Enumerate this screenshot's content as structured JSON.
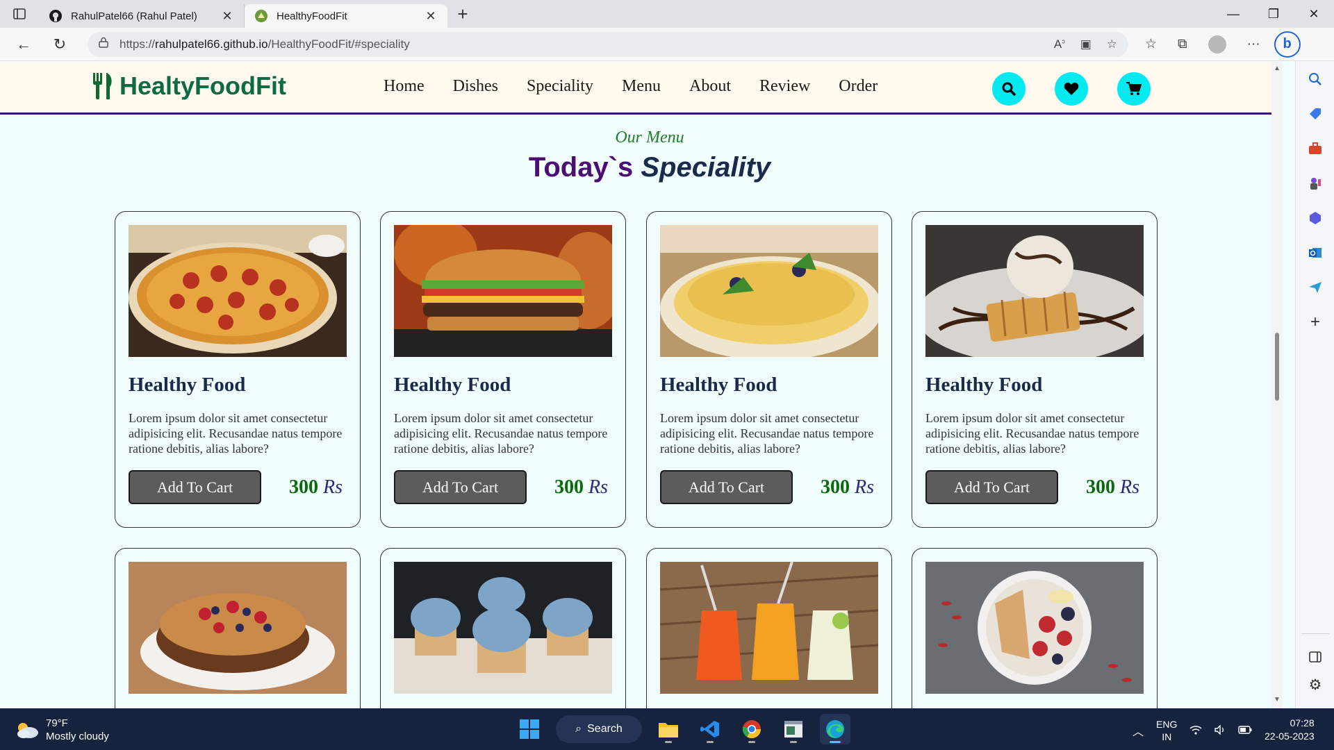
{
  "browser": {
    "tabs": [
      {
        "title": "RahulPatel66 (Rahul Patel)",
        "icon": "github-icon",
        "active": false
      },
      {
        "title": "HealthyFoodFit",
        "icon": "site-favicon",
        "active": true
      }
    ],
    "url_prefix": "https://",
    "url_host": "rahulpatel66.github.io",
    "url_path": "/HealthyFoodFit/#speciality"
  },
  "site": {
    "logo_text": "HealtyFoodFit",
    "nav": [
      "Home",
      "Dishes",
      "Speciality",
      "Menu",
      "About",
      "Review",
      "Order"
    ],
    "header_icons": [
      "search-icon",
      "heart-icon",
      "cart-icon"
    ],
    "section_sub": "Our Menu",
    "section_title_a": "Today`s ",
    "section_title_b": "Speciality",
    "cards": [
      {
        "title": "Healthy Food",
        "desc": "Lorem ipsum dolor sit amet consectetur adipisicing elit. Recusandae natus tempore ratione debitis, alias labore?",
        "button": "Add To Cart",
        "price": "300",
        "currency": "Rs",
        "image": "pizza"
      },
      {
        "title": "Healthy Food",
        "desc": "Lorem ipsum dolor sit amet consectetur adipisicing elit. Recusandae natus tempore ratione debitis, alias labore?",
        "button": "Add To Cart",
        "price": "300",
        "currency": "Rs",
        "image": "burger"
      },
      {
        "title": "Healthy Food",
        "desc": "Lorem ipsum dolor sit amet consectetur adipisicing elit. Recusandae natus tempore ratione debitis, alias labore?",
        "button": "Add To Cart",
        "price": "300",
        "currency": "Rs",
        "image": "crepes"
      },
      {
        "title": "Healthy Food",
        "desc": "Lorem ipsum dolor sit amet consectetur adipisicing elit. Recusandae natus tempore ratione debitis, alias labore?",
        "button": "Add To Cart",
        "price": "300",
        "currency": "Rs",
        "image": "waffle"
      },
      {
        "image": "cake"
      },
      {
        "image": "cupcakes"
      },
      {
        "image": "juices"
      },
      {
        "image": "fruit-bowl"
      }
    ],
    "colors": {
      "header_bg": "#fff9ee",
      "accent_cyan": "#00eaf0",
      "brand_green": "#0e6a44",
      "title_purple": "#4a0f72",
      "price_green": "#0b6b0b"
    }
  },
  "taskbar": {
    "temp": "79°F",
    "weather": "Mostly cloudy",
    "search": "Search",
    "lang_top": "ENG",
    "lang_bottom": "IN",
    "time": "07:28",
    "date": "22-05-2023"
  }
}
